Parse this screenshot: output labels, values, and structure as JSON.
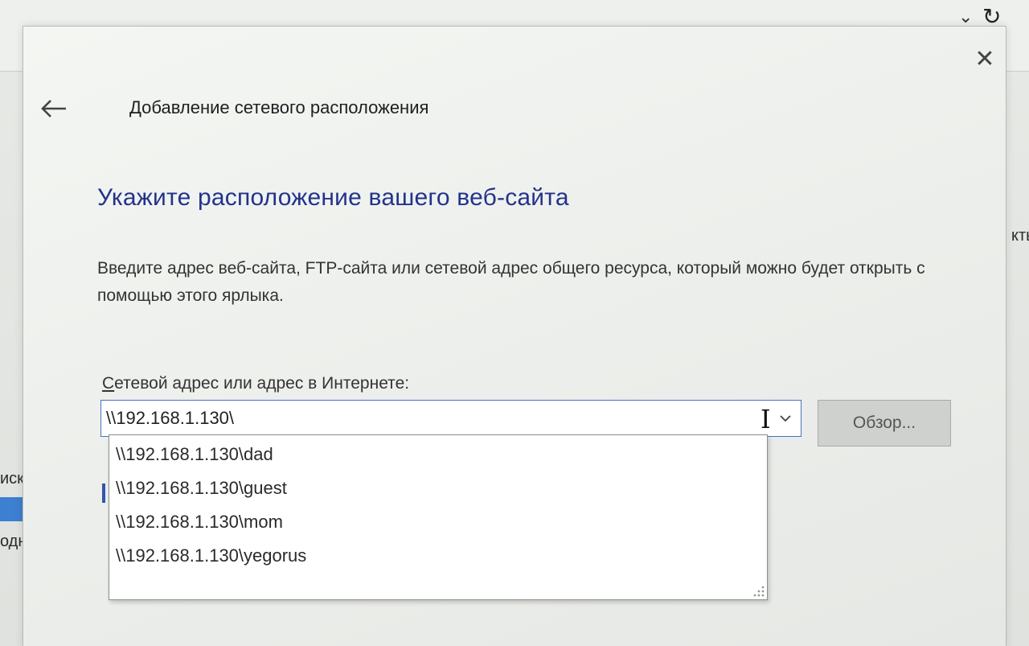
{
  "background": {
    "left_texts": [
      "иск",
      "однс"
    ],
    "right_text": "кты"
  },
  "dialog": {
    "title": "Добавление сетевого расположения",
    "heading": "Укажите расположение вашего веб-сайта",
    "description": "Введите адрес веб-сайта, FTP-сайта или сетевой адрес общего ресурса, который можно будет открыть с помощью этого ярлыка.",
    "field_label_accel": "С",
    "field_label_rest": "етевой адрес или адрес в Интернете:",
    "address_value": "\\\\192.168.1.130\\",
    "browse_label": "Обзор...",
    "suggestions": [
      "\\\\192.168.1.130\\dad",
      "\\\\192.168.1.130\\guest",
      "\\\\192.168.1.130\\mom",
      "\\\\192.168.1.130\\yegorus"
    ]
  },
  "colors": {
    "heading": "#23338c",
    "focus_border": "#4a6fc4"
  },
  "icons": {
    "back": "arrow-left-icon",
    "close": "close-icon",
    "dropdown": "chevron-down-icon",
    "refresh": "refresh-icon"
  }
}
